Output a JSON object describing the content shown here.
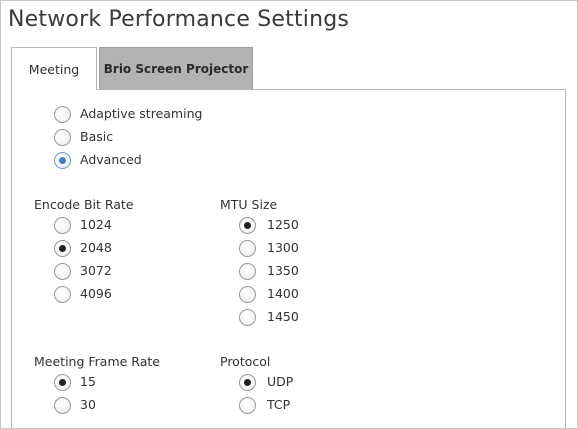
{
  "window": {
    "title": "Network Performance Settings"
  },
  "tabs": [
    {
      "label": "Meeting",
      "selected": true
    },
    {
      "label": "Brio Screen Projector",
      "selected": false
    }
  ],
  "mode": {
    "options": [
      "Adaptive streaming",
      "Basic",
      "Advanced"
    ],
    "selected": "Advanced"
  },
  "encode_bit_rate": {
    "label": "Encode Bit Rate",
    "options": [
      "1024",
      "2048",
      "3072",
      "4096"
    ],
    "selected": "2048"
  },
  "mtu_size": {
    "label": "MTU Size",
    "options": [
      "1250",
      "1300",
      "1350",
      "1400",
      "1450"
    ],
    "selected": "1250"
  },
  "meeting_frame_rate": {
    "label": "Meeting Frame Rate",
    "options": [
      "15",
      "30"
    ],
    "selected": "15"
  },
  "protocol": {
    "label": "Protocol",
    "options": [
      "UDP",
      "TCP"
    ],
    "selected": "UDP"
  },
  "colors": {
    "selected_tab_bg": "#ffffff",
    "unselected_tab_bg": "#b3b3b3",
    "accent_radio": "#3f7fc6"
  }
}
